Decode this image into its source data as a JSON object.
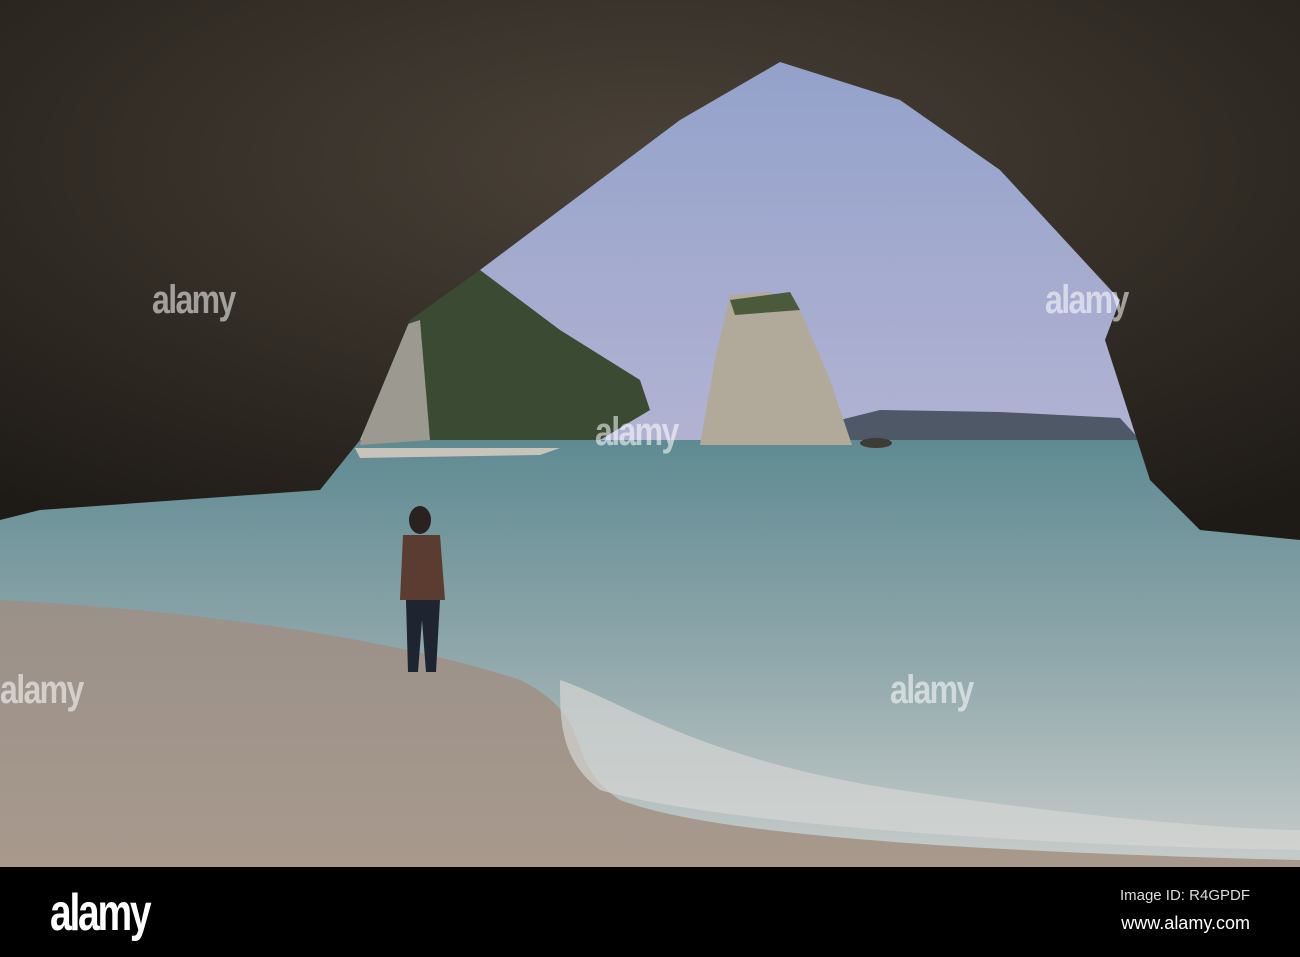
{
  "photo": {
    "subject": "sea-cave-arch-beach"
  },
  "watermark": {
    "text": "alamy"
  },
  "footer": {
    "logo": "alamy",
    "image_id": "Image ID: R4GPDF",
    "website": "www.alamy.com"
  }
}
